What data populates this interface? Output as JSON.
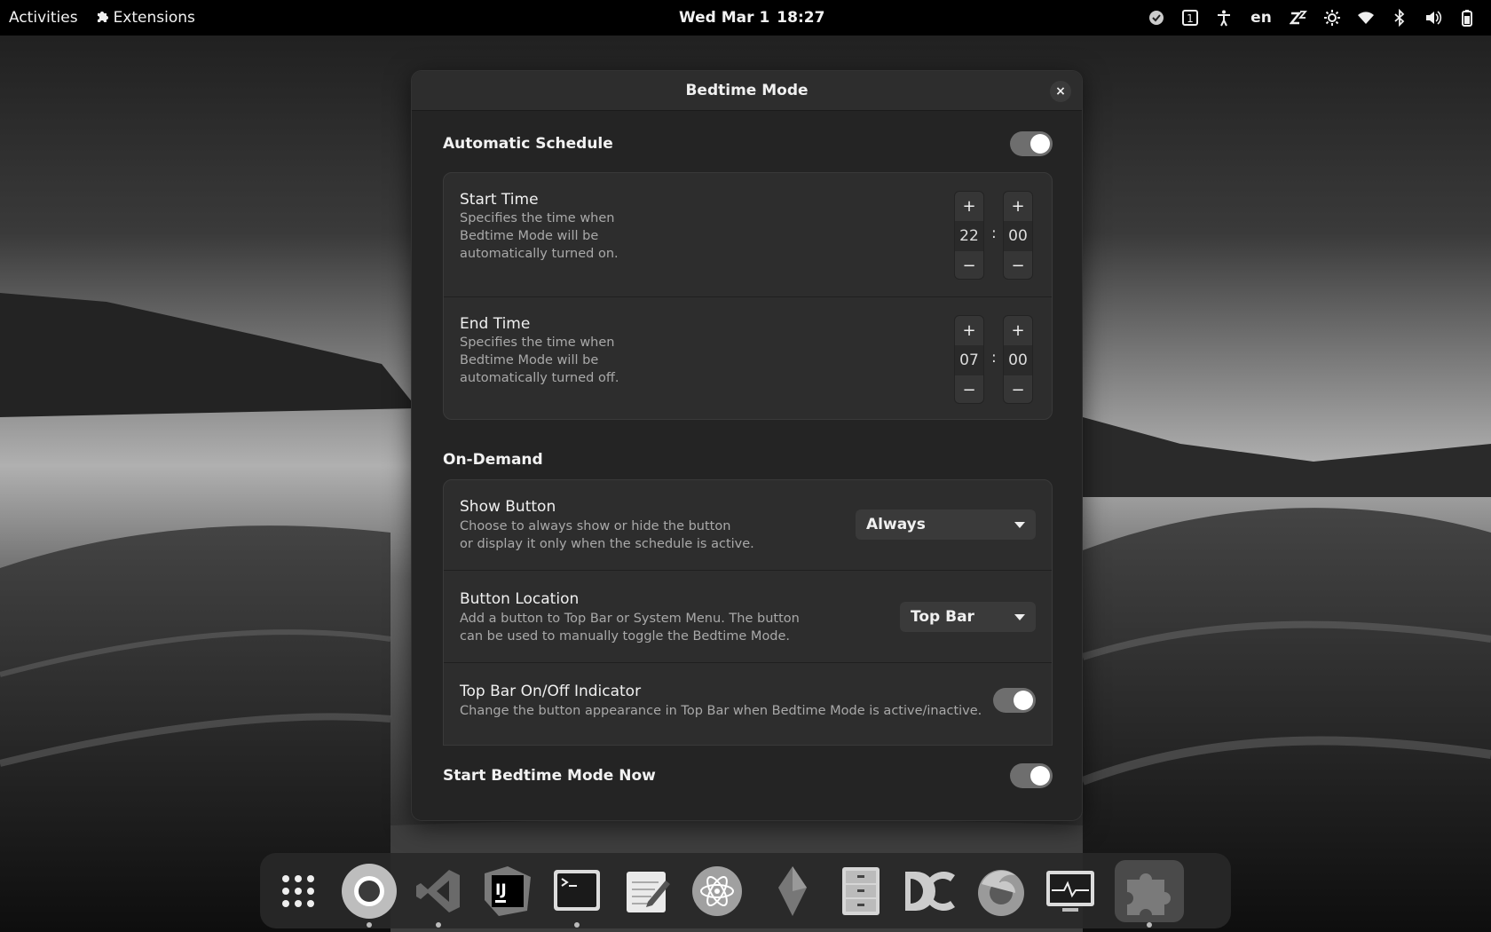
{
  "topbar": {
    "activities": "Activities",
    "extensions": "Extensions",
    "date": "Wed Mar 1",
    "time": "18:27",
    "workspace": "1",
    "language": "en",
    "tray_icons": [
      "shield-check-icon",
      "workspace-icon",
      "accessibility-icon",
      "language-indicator",
      "bedtime-zz-icon",
      "brightness-icon",
      "wifi-icon",
      "bluetooth-icon",
      "volume-icon",
      "battery-icon"
    ]
  },
  "dialog": {
    "title": "Bedtime Mode",
    "close": "×",
    "automatic_schedule": {
      "title": "Automatic Schedule",
      "enabled": true,
      "start": {
        "title": "Start Time",
        "description": [
          "Specifies the time when",
          "Bedtime Mode will be",
          "automatically turned on."
        ],
        "hours": "22",
        "minutes": "00"
      },
      "end": {
        "title": "End Time",
        "description": [
          "Specifies the time when",
          "Bedtime Mode will be",
          "automatically turned off."
        ],
        "hours": "07",
        "minutes": "00"
      },
      "plus": "+",
      "minus": "−",
      "separator": ":"
    },
    "on_demand": {
      "title": "On-Demand",
      "show_button": {
        "title": "Show Button",
        "description": [
          "Choose to always show or hide the button",
          "or display it only when the schedule is active."
        ],
        "value": "Always"
      },
      "button_location": {
        "title": "Button Location",
        "description": [
          "Add a button to Top Bar or System Menu. The button",
          "can be used to manually toggle the Bedtime Mode."
        ],
        "value": "Top Bar"
      },
      "indicator": {
        "title": "Top Bar On/Off Indicator",
        "description": "Change the button appearance in Top Bar when Bedtime Mode is active/inactive.",
        "enabled": true
      }
    },
    "start_now": {
      "title": "Start Bedtime Mode Now",
      "enabled": true
    }
  },
  "dock": {
    "apps": [
      "app-grid",
      "chromium",
      "vscode",
      "intellij-idea",
      "terminal",
      "text-editor",
      "atom",
      "inkscape",
      "file-cabinet",
      "dconf-editor",
      "firefox",
      "system-monitor",
      "extensions"
    ],
    "running": [
      "chromium",
      "vscode",
      "terminal",
      "extensions"
    ]
  }
}
